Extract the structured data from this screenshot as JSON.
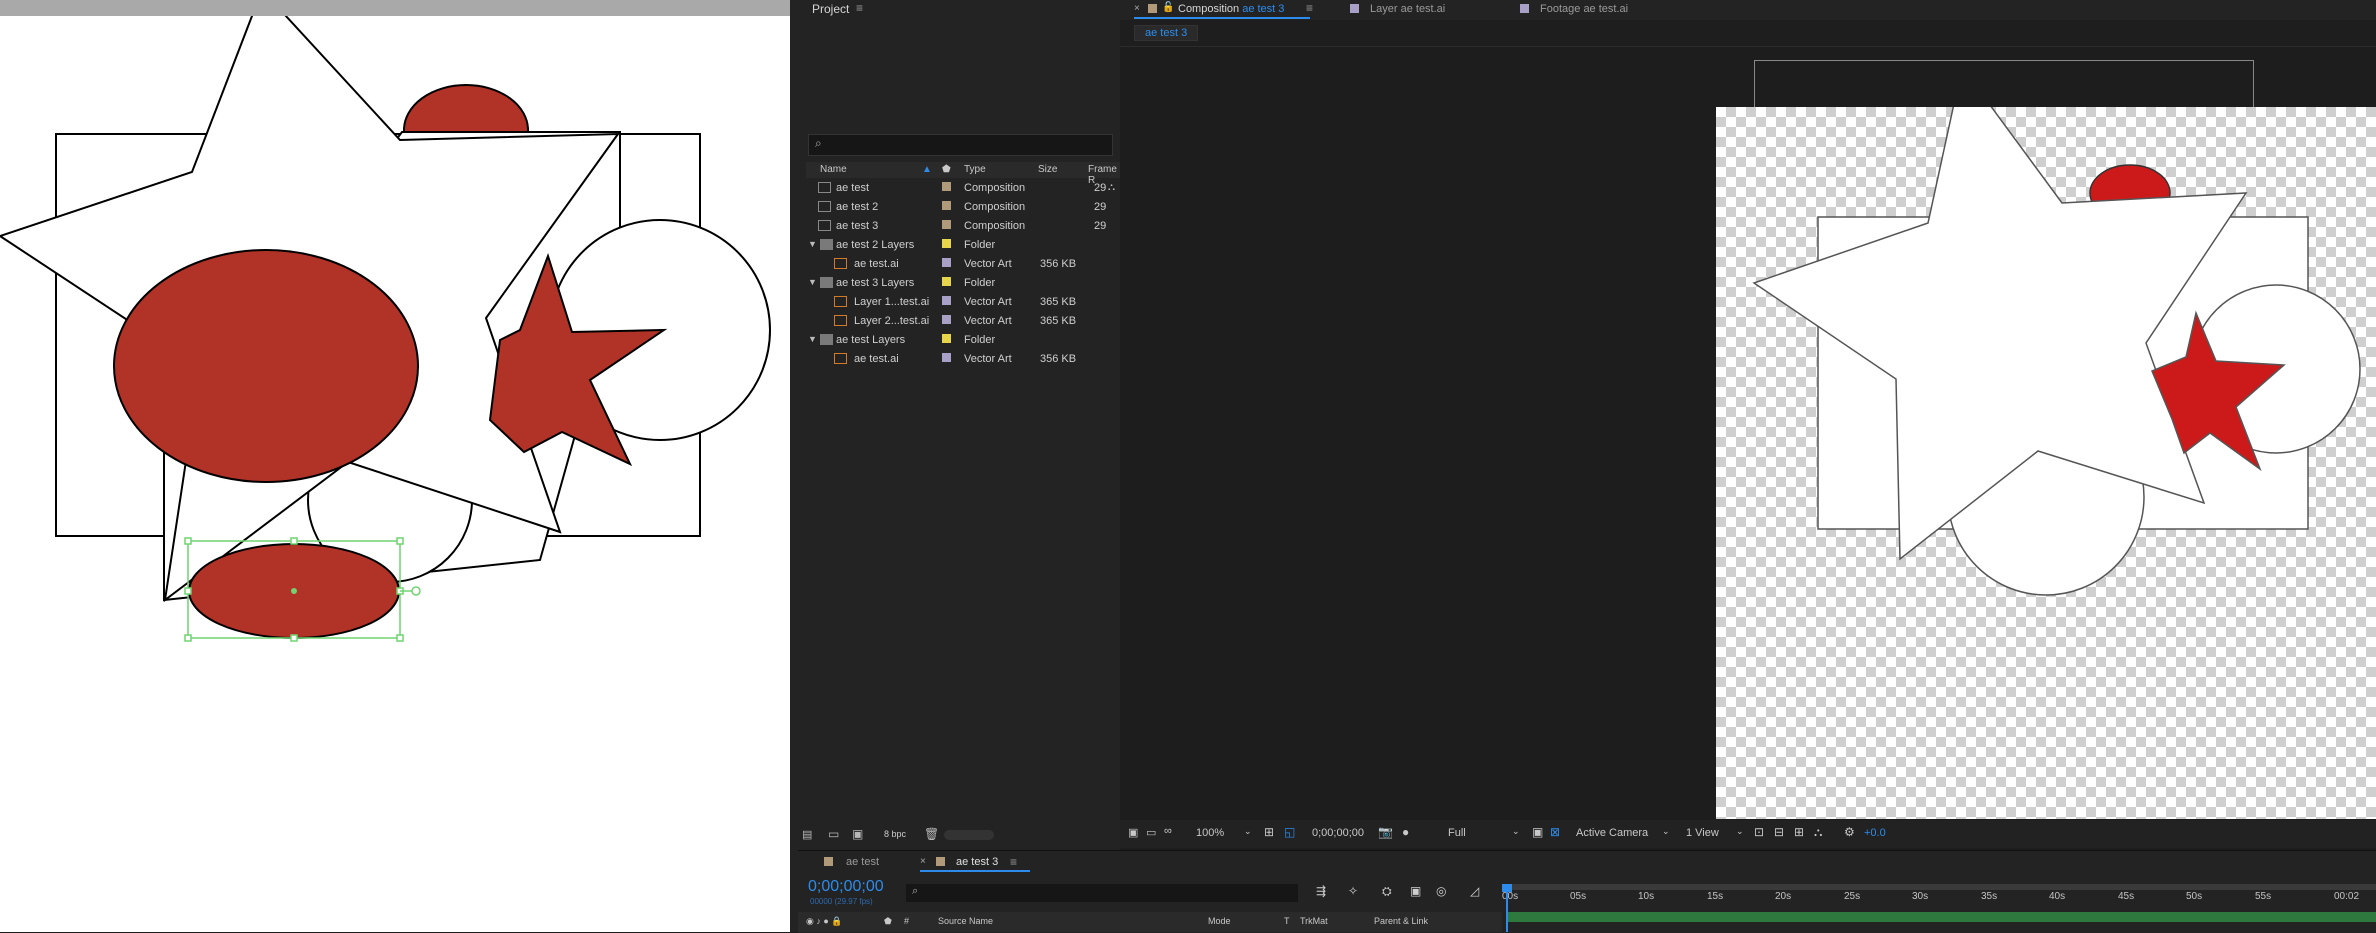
{
  "project": {
    "title": "Project",
    "search_placeholder": "",
    "columns": {
      "name": "Name",
      "type": "Type",
      "size": "Size",
      "frame": "Frame R"
    },
    "items": [
      {
        "name": "ae test",
        "type": "Composition",
        "size": "",
        "frame": "29",
        "color": "#b19a7a",
        "kind": "comp",
        "indent": 0
      },
      {
        "name": "ae test 2",
        "type": "Composition",
        "size": "",
        "frame": "29",
        "color": "#b19a7a",
        "kind": "comp",
        "indent": 0
      },
      {
        "name": "ae test 3",
        "type": "Composition",
        "size": "",
        "frame": "29",
        "color": "#b19a7a",
        "kind": "comp",
        "indent": 0
      },
      {
        "name": "ae test 2 Layers",
        "type": "Folder",
        "size": "",
        "frame": "",
        "color": "#e6d54a",
        "kind": "folder",
        "indent": 0
      },
      {
        "name": "ae test.ai",
        "type": "Vector Art",
        "size": "356 KB",
        "frame": "",
        "color": "#a9a0c8",
        "kind": "ai",
        "indent": 1
      },
      {
        "name": "ae test 3 Layers",
        "type": "Folder",
        "size": "",
        "frame": "",
        "color": "#e6d54a",
        "kind": "folder",
        "indent": 0
      },
      {
        "name": "Layer 1...test.ai",
        "type": "Vector Art",
        "size": "365 KB",
        "frame": "",
        "color": "#a9a0c8",
        "kind": "ai",
        "indent": 1
      },
      {
        "name": "Layer 2...test.ai",
        "type": "Vector Art",
        "size": "365 KB",
        "frame": "",
        "color": "#a9a0c8",
        "kind": "ai",
        "indent": 1
      },
      {
        "name": "ae test Layers",
        "type": "Folder",
        "size": "",
        "frame": "",
        "color": "#e6d54a",
        "kind": "folder",
        "indent": 0
      },
      {
        "name": "ae test.ai",
        "type": "Vector Art",
        "size": "356 KB",
        "frame": "",
        "color": "#a9a0c8",
        "kind": "ai",
        "indent": 1
      }
    ],
    "bpc": "8 bpc"
  },
  "viewer": {
    "tabs": [
      {
        "prefix": "Composition",
        "name": "ae test 3"
      },
      {
        "prefix": "Layer",
        "name": "ae test.ai"
      },
      {
        "prefix": "Footage",
        "name": "ae test.ai"
      }
    ],
    "sub_tab": "ae test 3",
    "zoom": "100%",
    "timecode": "0;00;00;00",
    "resolution": "Full",
    "camera": "Active Camera",
    "views": "1 View",
    "exposure": "+0.0"
  },
  "timeline": {
    "tabs": [
      "ae test",
      "ae test 3"
    ],
    "timecode": "0;00;00;00",
    "fps": "00000 (29.97 fps)",
    "columns": {
      "source": "Source Name",
      "mode": "Mode",
      "t": "T",
      "trkmat": "TrkMat",
      "parent": "Parent & Link"
    },
    "ticks": [
      "00s",
      "05s",
      "10s",
      "15s",
      "20s",
      "25s",
      "30s",
      "35s",
      "40s",
      "45s",
      "50s",
      "55s",
      "00:02"
    ]
  },
  "colors": {
    "accent": "#2d8ceb",
    "red": "#b13226",
    "bright_red": "#cc1a1a",
    "selection": "#6fd46f"
  }
}
